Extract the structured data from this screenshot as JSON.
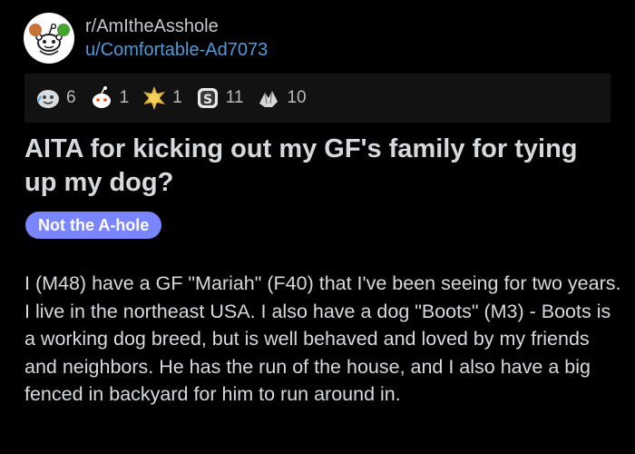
{
  "post": {
    "subreddit": "r/AmItheAsshole",
    "username": "u/Comfortable-Ad7073",
    "title": "AITA for kicking out my GF's family for tying up my dog?",
    "flair": "Not the A-hole",
    "body": "I (M48) have a GF \"Mariah\" (F40) that I've been seeing for two years. I live in the northeast USA. I also have a dog \"Boots\" (M3) - Boots is a working dog breed, but is well behaved and loved by my friends and neighbors. He has the run of the house, and I also have a big fenced in backyard for him to run around in."
  },
  "awards": [
    {
      "icon": "face-tears-award-icon",
      "count": "6"
    },
    {
      "icon": "snoo-award-icon",
      "count": "1"
    },
    {
      "icon": "gold-burst-award-icon",
      "count": "1"
    },
    {
      "icon": "s-coin-award-icon",
      "count": "11"
    },
    {
      "icon": "hands-award-icon",
      "count": "10"
    }
  ],
  "colors": {
    "background": "#000000",
    "username": "#4f9bd9",
    "flair_bg": "#7a86ff",
    "text": "#d7dadc"
  }
}
